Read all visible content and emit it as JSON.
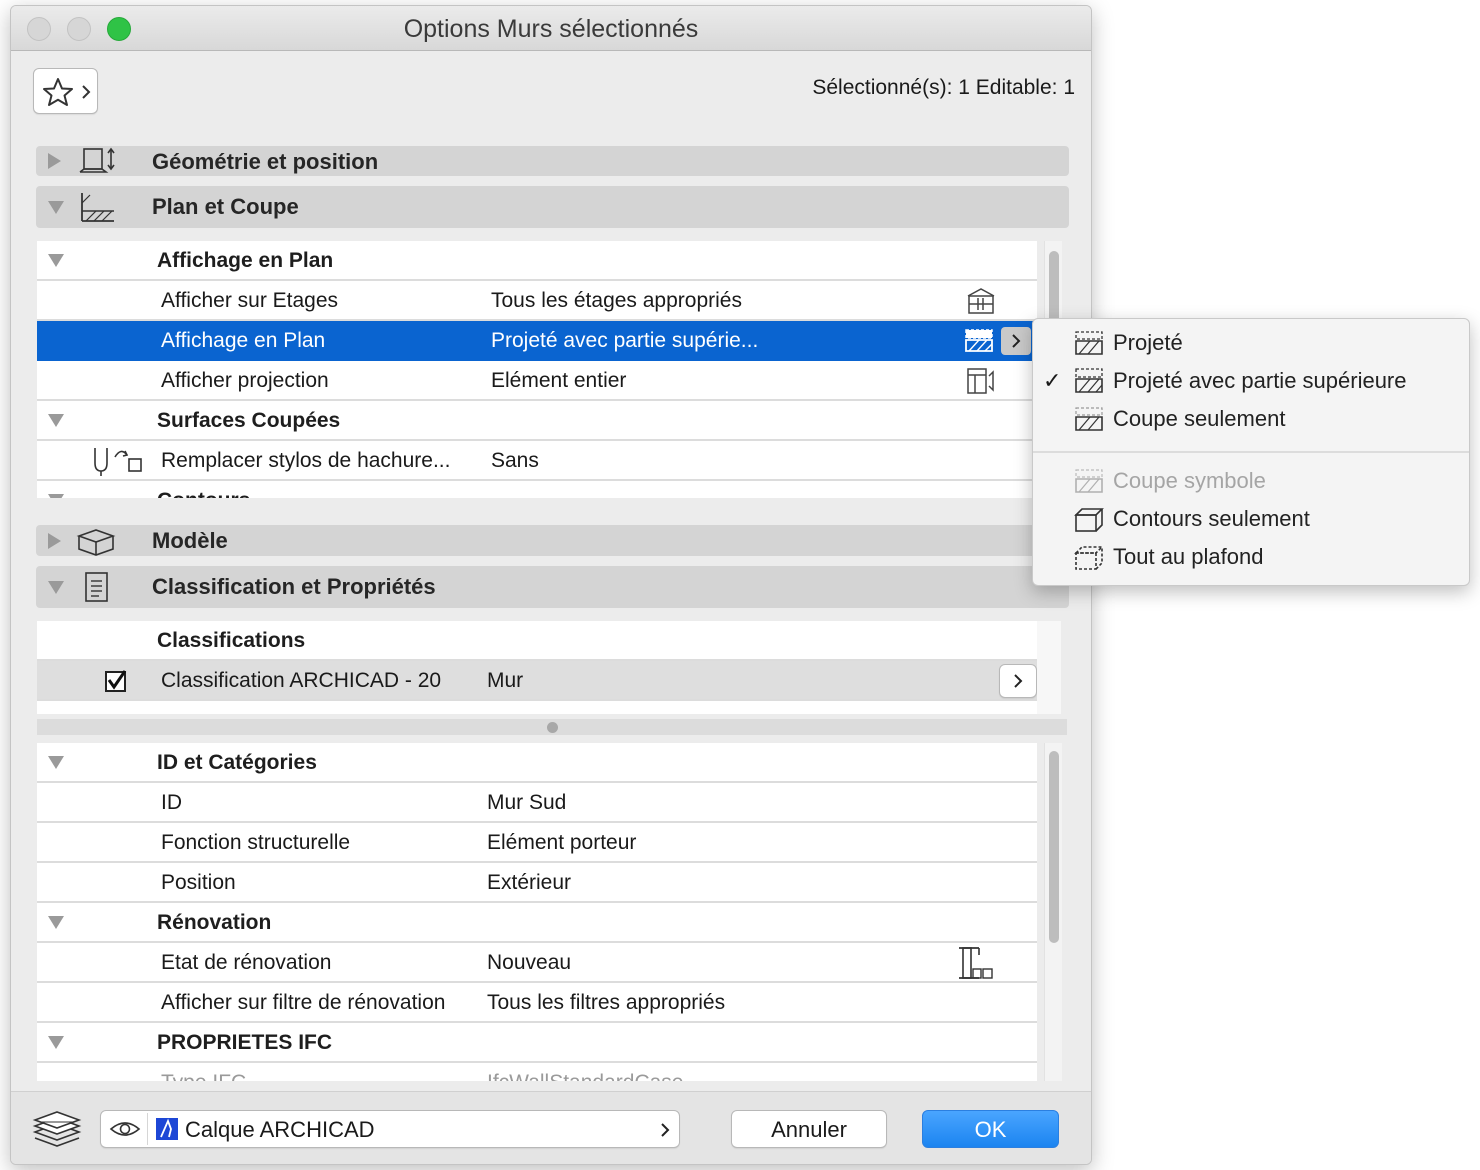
{
  "window": {
    "title": "Options Murs sélectionnés"
  },
  "header": {
    "selection_status": "Sélectionné(s): 1 Editable: 1"
  },
  "sections": {
    "geometry": "Géométrie et position",
    "plan": "Plan et Coupe",
    "model": "Modèle",
    "classification": "Classification et Propriétés"
  },
  "plan_table": {
    "group1": "Affichage en Plan",
    "rows": [
      {
        "label": "Afficher sur Etages",
        "value": "Tous les étages appropriés"
      },
      {
        "label": "Affichage en Plan",
        "value": "Projeté avec partie supérie..."
      },
      {
        "label": "Afficher projection",
        "value": "Elément entier"
      }
    ],
    "group2": "Surfaces Coupées",
    "row_pens": {
      "label": "Remplacer stylos de hachure...",
      "value": "Sans"
    },
    "group3_clipped": "Contours"
  },
  "classifications": {
    "header": "Classifications",
    "row": {
      "label": "Classification ARCHICAD - 20",
      "value": "Mur",
      "checked": true
    }
  },
  "props_table": {
    "group1": "ID et Catégories",
    "rows1": [
      {
        "label": "ID",
        "value": "Mur Sud"
      },
      {
        "label": "Fonction structurelle",
        "value": "Elément porteur"
      },
      {
        "label": "Position",
        "value": "Extérieur"
      }
    ],
    "group2": "Rénovation",
    "rows2": [
      {
        "label": "Etat de rénovation",
        "value": "Nouveau"
      },
      {
        "label": "Afficher sur filtre de rénovation",
        "value": "Tous les filtres appropriés"
      }
    ],
    "group3": "PROPRIETES IFC",
    "clipped_row": {
      "label": "Type IFC",
      "value": "IfcWallStandardCase"
    }
  },
  "footer": {
    "layer": "Calque ARCHICAD",
    "cancel": "Annuler",
    "ok": "OK"
  },
  "popup_menu": {
    "items": [
      {
        "label": "Projeté",
        "checked": false,
        "disabled": false,
        "icon": "projected-icon"
      },
      {
        "label": "Projeté avec partie supérieure",
        "checked": true,
        "disabled": false,
        "icon": "projected-overhead-icon"
      },
      {
        "label": "Coupe seulement",
        "checked": false,
        "disabled": false,
        "icon": "cut-only-icon"
      },
      {
        "label": "Coupe symbole",
        "checked": false,
        "disabled": true,
        "icon": "symbolic-cut-icon"
      },
      {
        "label": "Contours seulement",
        "checked": false,
        "disabled": false,
        "icon": "outlines-only-icon"
      },
      {
        "label": "Tout au plafond",
        "checked": false,
        "disabled": false,
        "icon": "overhead-all-icon"
      }
    ],
    "check_mark": "✓"
  },
  "colors": {
    "selection": "#0a64d0",
    "ok_button": "#1b8cf0",
    "traffic_green": "#2fc346"
  }
}
